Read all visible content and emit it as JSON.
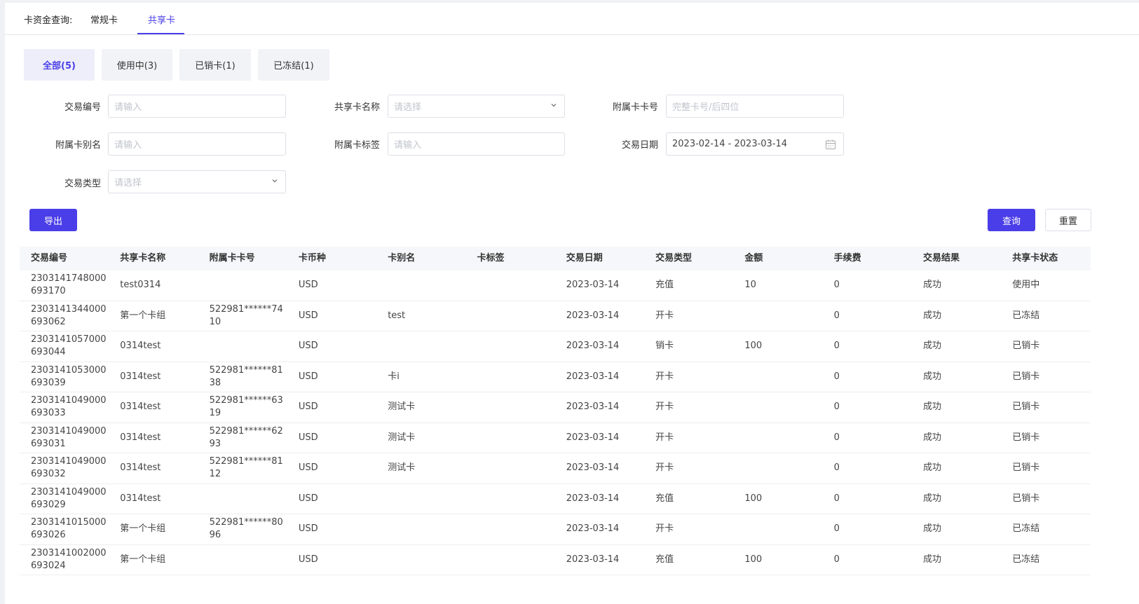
{
  "header": {
    "prefix": "卡资金查询:",
    "tabs": [
      {
        "label": "常规卡",
        "active": false
      },
      {
        "label": "共享卡",
        "active": true
      }
    ]
  },
  "status_tabs": [
    {
      "label": "全部(5)",
      "active": true
    },
    {
      "label": "使用中(3)",
      "active": false
    },
    {
      "label": "已销卡(1)",
      "active": false
    },
    {
      "label": "已冻结(1)",
      "active": false
    }
  ],
  "form": {
    "trade_no": {
      "label": "交易编号",
      "placeholder": "请输入"
    },
    "share_card_name": {
      "label": "共享卡名称",
      "placeholder": "请选择"
    },
    "sub_card_no": {
      "label": "附属卡卡号",
      "placeholder": "完整卡号/后四位"
    },
    "sub_card_alias": {
      "label": "附属卡别名",
      "placeholder": "请输入"
    },
    "sub_card_tag": {
      "label": "附属卡标签",
      "placeholder": "请输入"
    },
    "trade_date": {
      "label": "交易日期",
      "value": "2023-02-14 - 2023-03-14"
    },
    "trade_type": {
      "label": "交易类型",
      "placeholder": "请选择"
    }
  },
  "buttons": {
    "export": "导出",
    "query": "查询",
    "reset": "重置"
  },
  "table": {
    "columns": [
      "交易编号",
      "共享卡名称",
      "附属卡卡号",
      "卡币种",
      "卡别名",
      "卡标签",
      "交易日期",
      "交易类型",
      "金额",
      "手续费",
      "交易结果",
      "共享卡状态"
    ],
    "rows": [
      [
        "2303141748000693170",
        "test0314",
        "",
        "USD",
        "",
        "",
        "2023-03-14",
        "充值",
        "10",
        "0",
        "成功",
        "使用中"
      ],
      [
        "2303141344000693062",
        "第一个卡组",
        "522981******7410",
        "USD",
        "test",
        "",
        "2023-03-14",
        "开卡",
        "",
        "0",
        "成功",
        "已冻结"
      ],
      [
        "2303141057000693044",
        "0314test",
        "",
        "USD",
        "",
        "",
        "2023-03-14",
        "销卡",
        "100",
        "0",
        "成功",
        "已销卡"
      ],
      [
        "2303141053000693039",
        "0314test",
        "522981******8138",
        "USD",
        "卡i",
        "",
        "2023-03-14",
        "开卡",
        "",
        "0",
        "成功",
        "已销卡"
      ],
      [
        "2303141049000693033",
        "0314test",
        "522981******6319",
        "USD",
        "测试卡",
        "",
        "2023-03-14",
        "开卡",
        "",
        "0",
        "成功",
        "已销卡"
      ],
      [
        "2303141049000693031",
        "0314test",
        "522981******6293",
        "USD",
        "测试卡",
        "",
        "2023-03-14",
        "开卡",
        "",
        "0",
        "成功",
        "已销卡"
      ],
      [
        "2303141049000693032",
        "0314test",
        "522981******8112",
        "USD",
        "测试卡",
        "",
        "2023-03-14",
        "开卡",
        "",
        "0",
        "成功",
        "已销卡"
      ],
      [
        "2303141049000693029",
        "0314test",
        "",
        "USD",
        "",
        "",
        "2023-03-14",
        "充值",
        "100",
        "0",
        "成功",
        "已销卡"
      ],
      [
        "2303141015000693026",
        "第一个卡组",
        "522981******8096",
        "USD",
        "",
        "",
        "2023-03-14",
        "开卡",
        "",
        "0",
        "成功",
        "已冻结"
      ],
      [
        "2303141002000693024",
        "第一个卡组",
        "",
        "USD",
        "",
        "",
        "2023-03-14",
        "充值",
        "100",
        "0",
        "成功",
        "已冻结"
      ]
    ]
  },
  "colors": {
    "accent": "#4a3ee8"
  }
}
